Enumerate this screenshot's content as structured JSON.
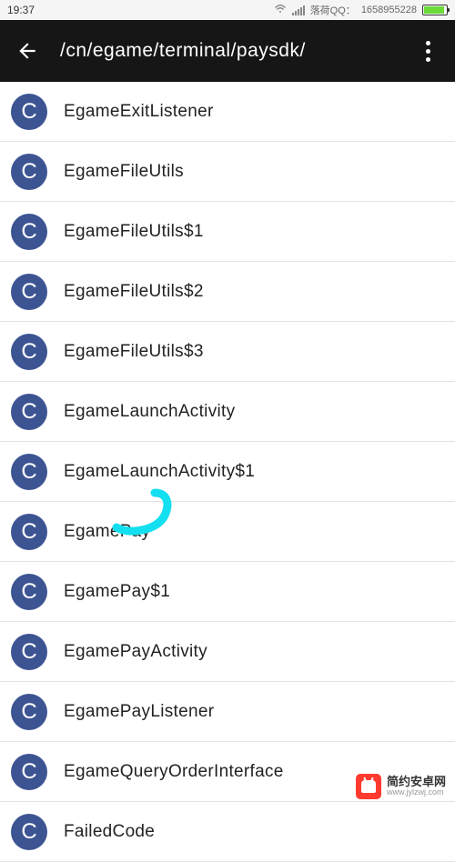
{
  "status": {
    "time": "19:37",
    "qq_label": "落荷QQ：",
    "qq_number": "1658955228"
  },
  "appbar": {
    "path": "/cn/egame/terminal/paysdk/"
  },
  "badge_letter": "C",
  "items": [
    {
      "name": "EgameExitListener"
    },
    {
      "name": "EgameFileUtils"
    },
    {
      "name": "EgameFileUtils$1"
    },
    {
      "name": "EgameFileUtils$2"
    },
    {
      "name": "EgameFileUtils$3"
    },
    {
      "name": "EgameLaunchActivity"
    },
    {
      "name": "EgameLaunchActivity$1"
    },
    {
      "name": "EgamePay"
    },
    {
      "name": "EgamePay$1"
    },
    {
      "name": "EgamePayActivity"
    },
    {
      "name": "EgamePayListener"
    },
    {
      "name": "EgameQueryOrderInterface"
    },
    {
      "name": "FailedCode"
    }
  ],
  "watermark": {
    "cn": "简约安卓网",
    "url": "www.jylzwj.com"
  }
}
